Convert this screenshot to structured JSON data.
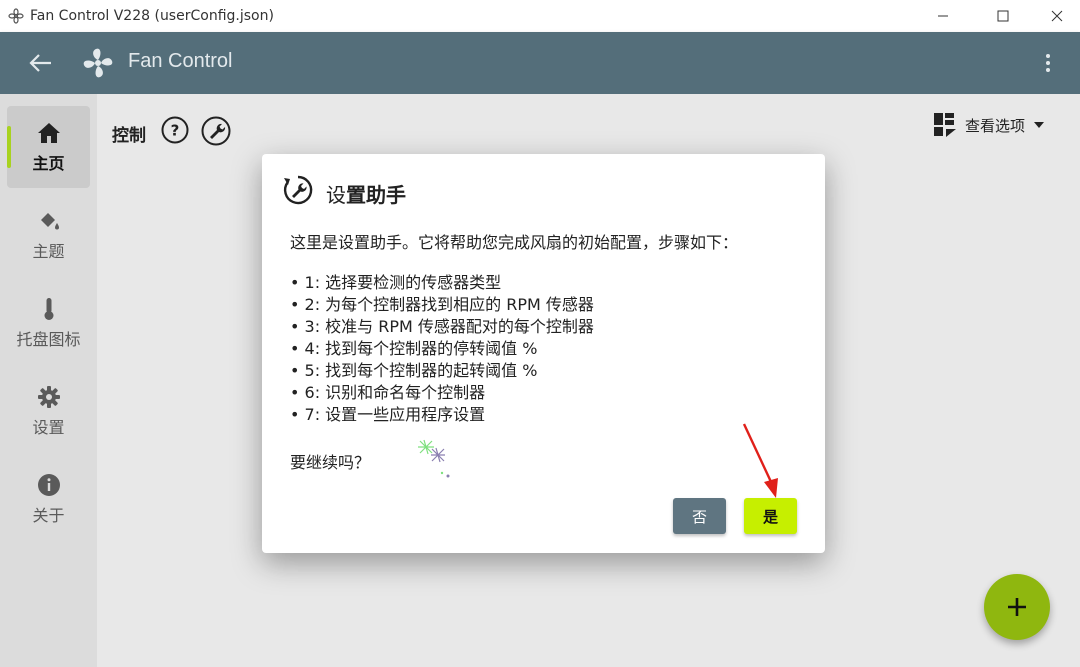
{
  "window": {
    "title": "Fan Control V228 (userConfig.json)",
    "controls": [
      "minimize",
      "maximize",
      "close"
    ]
  },
  "appbar": {
    "title": "Fan Control",
    "back_icon": "arrow-left-icon",
    "logo_icon": "fan-icon",
    "menu_icon": "more-vertical-icon"
  },
  "sidebar": {
    "items": [
      {
        "label": "主页",
        "icon": "home-icon",
        "active": true
      },
      {
        "label": "主题",
        "icon": "paint-bucket-icon",
        "active": false
      },
      {
        "label": "托盘图标",
        "icon": "thermometer-icon",
        "active": false
      },
      {
        "label": "设置",
        "icon": "gear-icon",
        "active": false
      },
      {
        "label": "关于",
        "icon": "info-icon",
        "active": false
      }
    ]
  },
  "main": {
    "section_title": "控制",
    "view_options_label": "查看选项"
  },
  "dialog": {
    "title_prefix": "设",
    "title_rest": "置助手",
    "intro": "这里是设置助手。它将帮助您完成风扇的初始配置，步骤如下：",
    "steps": [
      "• 1: 选择要检测的传感器类型",
      "• 2: 为每个控制器找到相应的 RPM 传感器",
      "• 3: 校准与 RPM 传感器配对的每个控制器",
      "• 4: 找到每个控制器的停转阈值 %",
      "• 5: 找到每个控制器的起转阈值 %",
      "• 6: 识别和命名每个控制器",
      "• 7: 设置一些应用程序设置"
    ],
    "question": "要继续吗？",
    "no_label": "否",
    "yes_label": "是"
  },
  "colors": {
    "appbar": "#546e7a",
    "accent": "#c6ef00",
    "fab": "#8fb70f",
    "no_button": "#5f7581"
  }
}
